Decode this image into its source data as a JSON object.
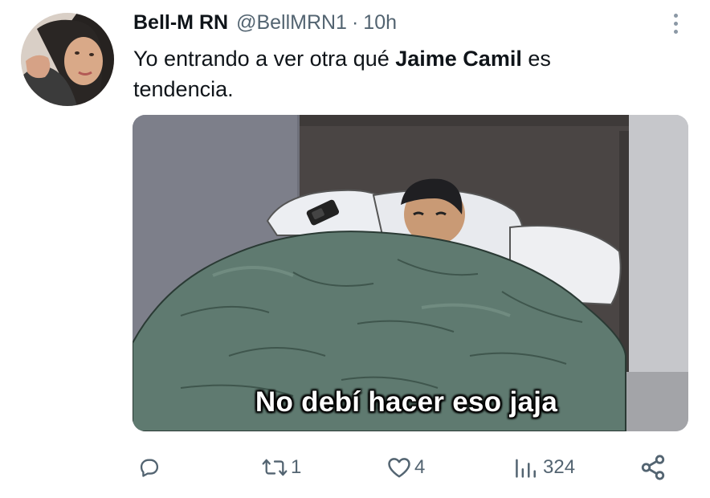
{
  "tweet": {
    "display_name": "Bell-M RN",
    "handle": "@BellMRN1",
    "separator": "·",
    "time": "10h",
    "text_before": "Yo entrando a ver otra qué ",
    "text_bold": "Jaime Camil",
    "text_after": " es tendencia."
  },
  "media": {
    "caption": "No debí hacer eso jaja"
  },
  "actions": {
    "reply_count": "",
    "retweet_count": "1",
    "like_count": "4",
    "views_count": "324"
  },
  "icons": [
    "reply-icon",
    "retweet-icon",
    "like-icon",
    "views-icon",
    "share-icon",
    "more-icon"
  ],
  "colors": {
    "secondary_text": "#536471",
    "blanket": "#5f7a70",
    "headboard": "#4a4544"
  }
}
